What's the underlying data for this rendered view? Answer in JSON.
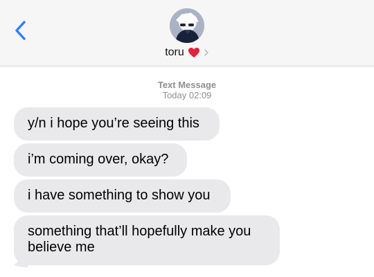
{
  "header": {
    "contact_name": "toru",
    "avatar_description": "anime avatar",
    "accent_color": "#1a73e8",
    "heart_color": "#e0243b"
  },
  "thread": {
    "service_label": "Text Message",
    "timestamp": "Today 02:09"
  },
  "messages": [
    {
      "text": "y/n i hope you’re seeing this"
    },
    {
      "text": "i’m coming over, okay?"
    },
    {
      "text": "i have something to show you"
    },
    {
      "text": "something that’ll hopefully make you\nbelieve me"
    }
  ]
}
